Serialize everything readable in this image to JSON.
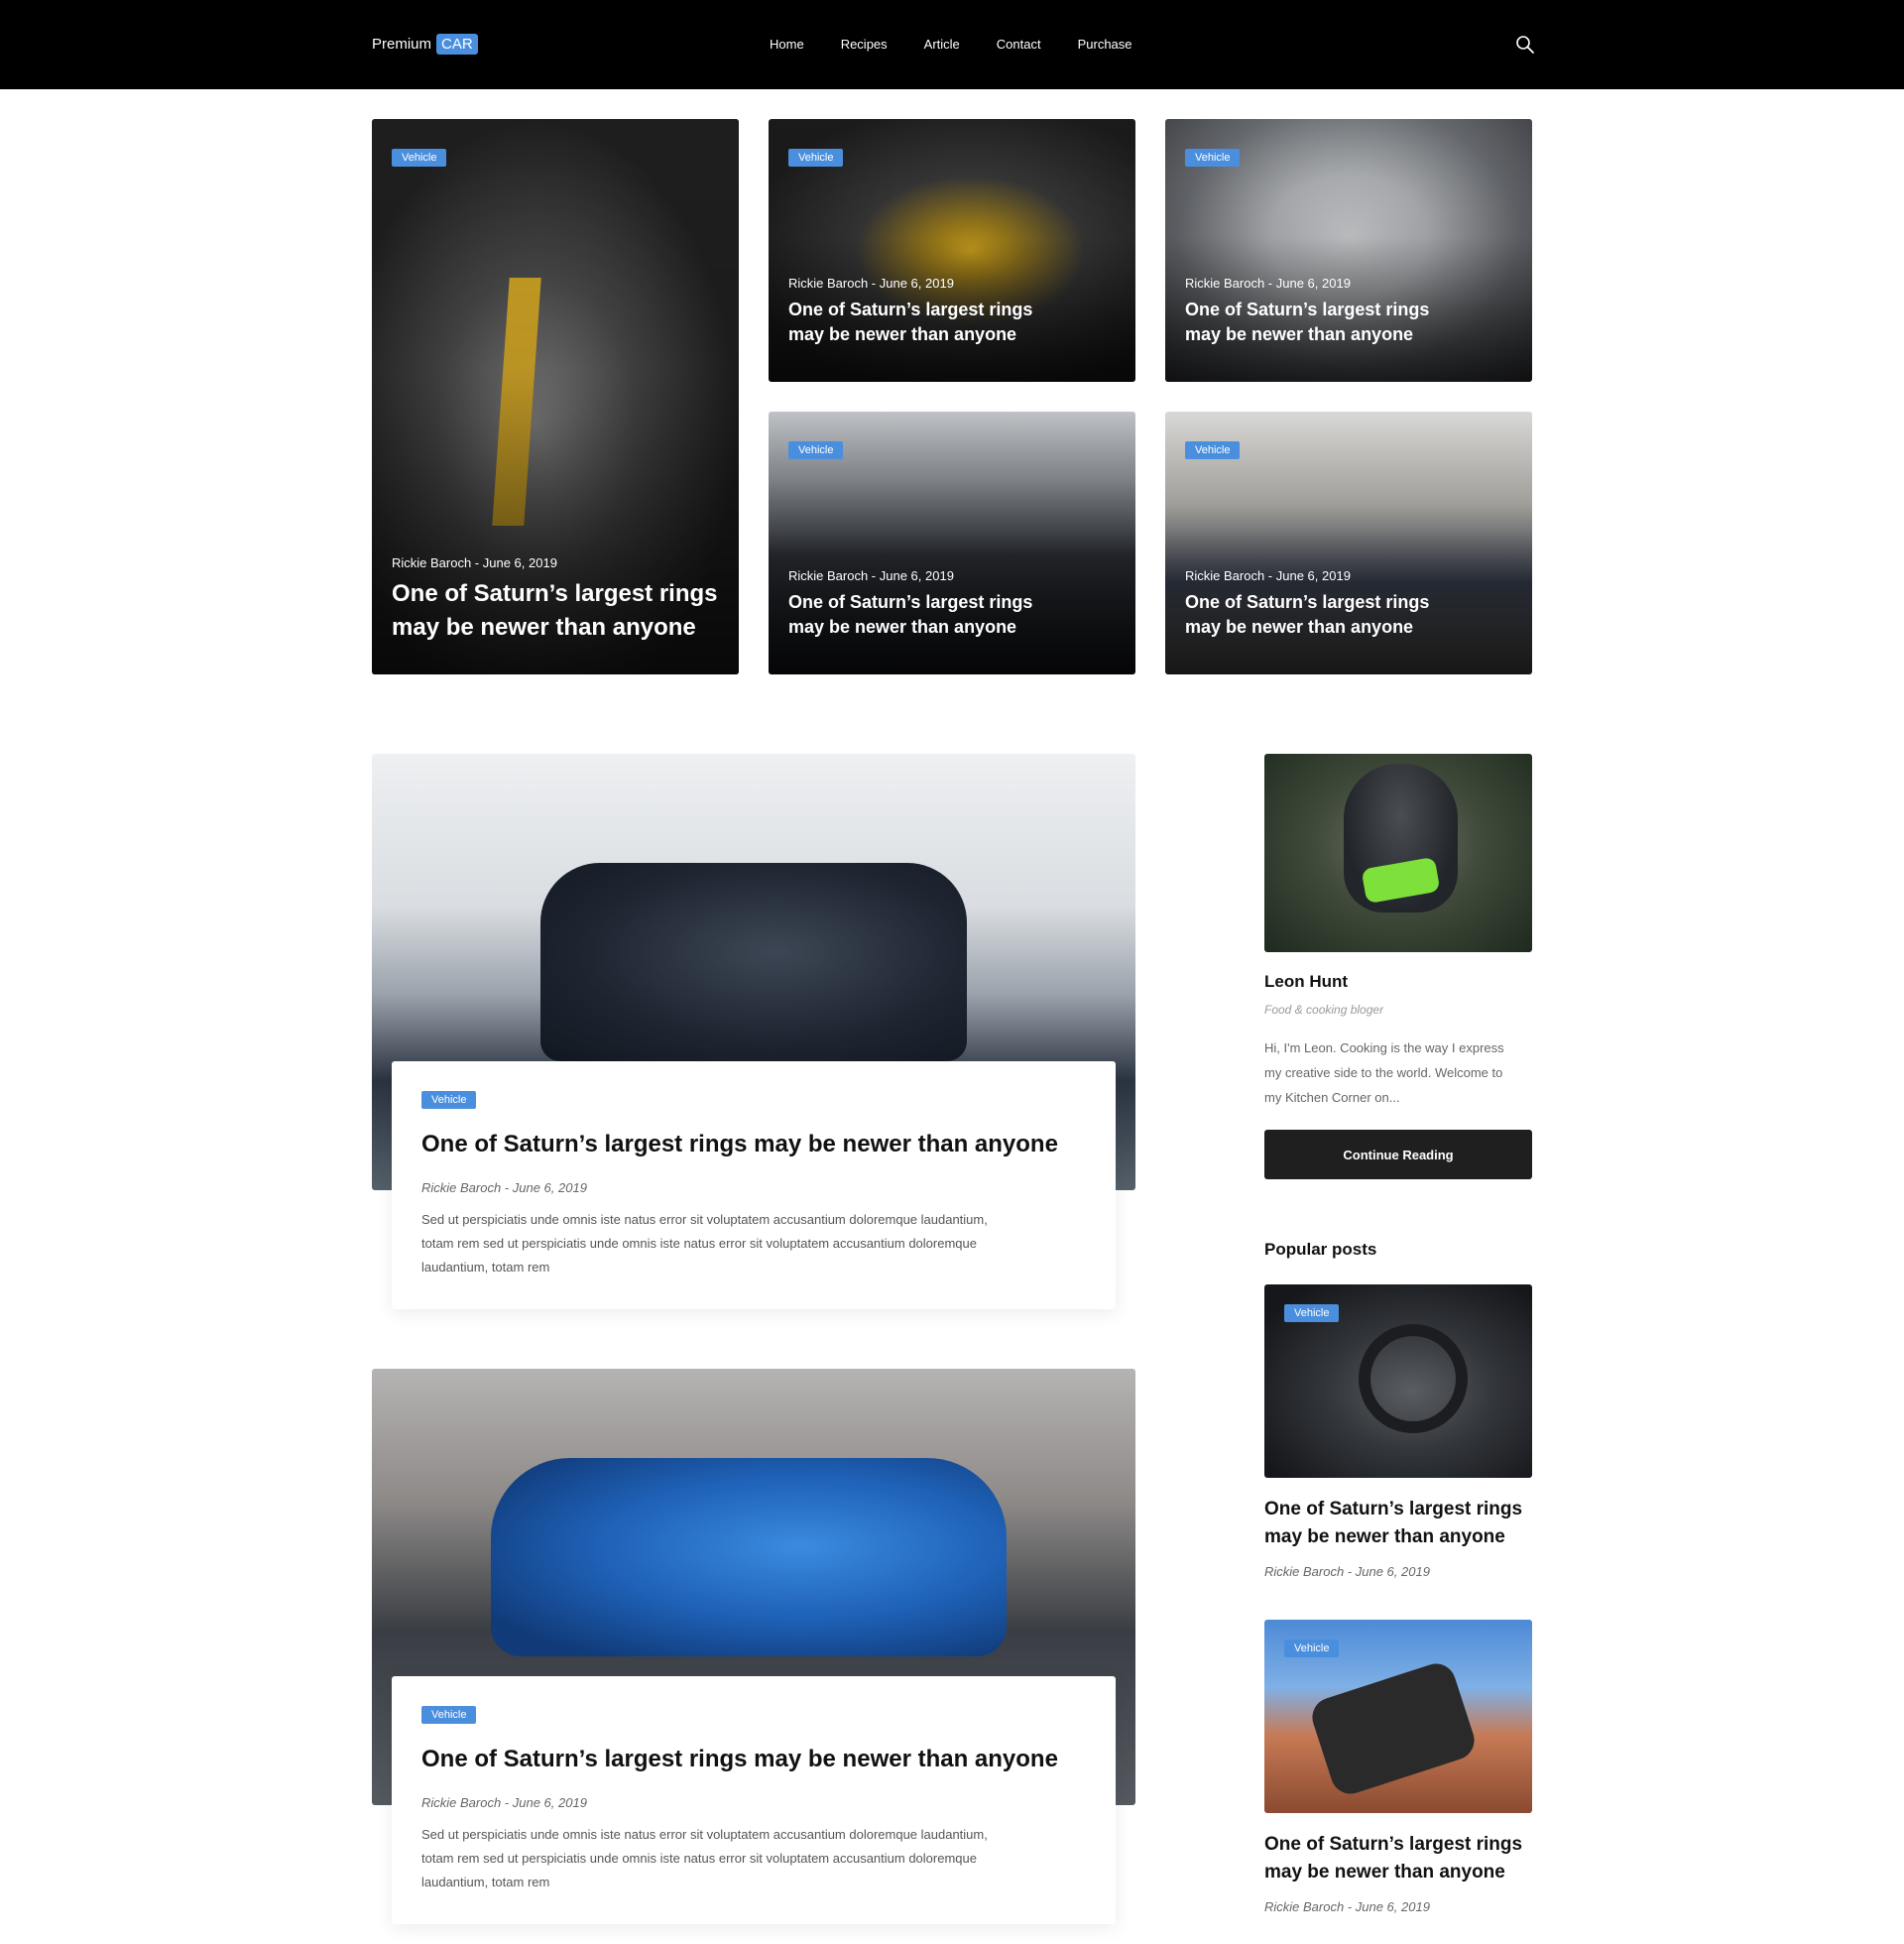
{
  "brand": {
    "text": "Premium",
    "badge": "CAR"
  },
  "nav": {
    "items": [
      "Home",
      "Recipes",
      "Article",
      "Contact",
      "Purchase"
    ]
  },
  "icons": {
    "search": "search-icon"
  },
  "colors": {
    "accent": "#4a8fde",
    "navbar": "#000000",
    "button": "#1f1f1f"
  },
  "featured": [
    {
      "badge": "Vehicle",
      "meta": "Rickie Baroch - June 6, 2019",
      "title_line1": "One of Saturn’s largest rings",
      "title_line2": "may be newer than anyone"
    },
    {
      "badge": "Vehicle",
      "meta": "Rickie Baroch - June 6, 2019",
      "title_line1": "One of Saturn’s largest rings",
      "title_line2": "may be newer than anyone"
    },
    {
      "badge": "Vehicle",
      "meta": "Rickie Baroch - June 6, 2019",
      "title_line1": "One of Saturn’s largest rings",
      "title_line2": "may be newer than anyone"
    },
    {
      "badge": "Vehicle",
      "meta": "Rickie Baroch - June 6, 2019",
      "title_line1": "One of Saturn’s largest rings",
      "title_line2": "may be newer than anyone"
    },
    {
      "badge": "Vehicle",
      "meta": "Rickie Baroch - June 6, 2019",
      "title_line1": "One of Saturn’s largest rings",
      "title_line2": "may be newer than anyone"
    }
  ],
  "posts": [
    {
      "badge": "Vehicle",
      "title": "One of Saturn’s largest rings may be newer than anyone",
      "meta": "Rickie Baroch - June 6, 2019",
      "excerpt_1": "Sed ut perspiciatis unde omnis iste natus error sit voluptatem accusantium doloremque laudantium,",
      "excerpt_2": "totam rem sed ut perspiciatis unde omnis iste natus error sit voluptatem accusantium doloremque",
      "excerpt_3": "laudantium, totam rem"
    },
    {
      "badge": "Vehicle",
      "title": "One of Saturn’s largest rings may be newer than anyone",
      "meta": "Rickie Baroch - June 6, 2019",
      "excerpt_1": "Sed ut perspiciatis unde omnis iste natus error sit voluptatem accusantium doloremque laudantium,",
      "excerpt_2": "totam rem sed ut perspiciatis unde omnis iste natus error sit voluptatem accusantium doloremque",
      "excerpt_3": "laudantium, totam rem"
    }
  ],
  "sidebar": {
    "author": {
      "name": "Leon Hunt",
      "role": "Food & cooking bloger",
      "bio_1": "Hi, I'm Leon. Cooking is the way I express",
      "bio_2": "my creative side to the world. Welcome to",
      "bio_3": "my Kitchen Corner on...",
      "button": "Continue Reading"
    },
    "popular_heading": "Popular posts",
    "popular": [
      {
        "badge": "Vehicle",
        "title_line1": "One of Saturn’s largest rings",
        "title_line2": "may be newer than anyone",
        "meta": "Rickie Baroch - June 6, 2019"
      },
      {
        "badge": "Vehicle",
        "title_line1": "One of Saturn’s largest rings",
        "title_line2": "may be newer than anyone",
        "meta": "Rickie Baroch - June 6, 2019"
      }
    ]
  }
}
